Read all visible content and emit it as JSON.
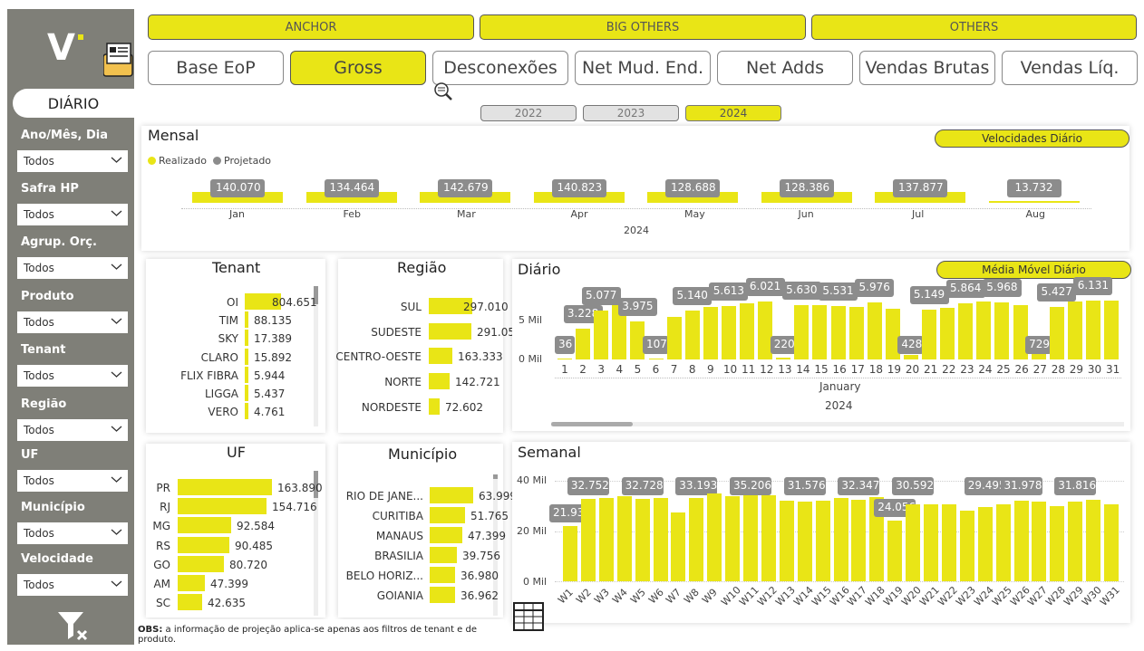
{
  "sidebar": {
    "logo": "V",
    "mode_label": "DIÁRIO",
    "filters": [
      {
        "label": "Ano/Mês, Dia",
        "value": "Todos"
      },
      {
        "label": "Safra HP",
        "value": "Todos"
      },
      {
        "label": "Agrup. Orç.",
        "value": "Todos"
      },
      {
        "label": "Produto",
        "value": "Todos"
      },
      {
        "label": "Tenant",
        "value": "Todos"
      },
      {
        "label": "Região",
        "value": "Todos"
      },
      {
        "label": "UF",
        "value": "Todos"
      },
      {
        "label": "Município",
        "value": "Todos"
      },
      {
        "label": "Velocidade",
        "value": "Todos"
      }
    ]
  },
  "segment_buttons": [
    "ANCHOR",
    "BIG OTHERS",
    "OTHERS"
  ],
  "metric_buttons": [
    {
      "label": "Base EoP",
      "active": false
    },
    {
      "label": "Gross",
      "active": true
    },
    {
      "label": "Desconexões",
      "active": false
    },
    {
      "label": "Net Mud. End.",
      "active": false
    },
    {
      "label": "Net Adds",
      "active": false
    },
    {
      "label": "Vendas Brutas",
      "active": false
    },
    {
      "label": "Vendas Líq.",
      "active": false
    }
  ],
  "year_buttons": [
    {
      "label": "2022",
      "active": false
    },
    {
      "label": "2023",
      "active": false
    },
    {
      "label": "2024",
      "active": true
    }
  ],
  "mensal": {
    "title": "Mensal",
    "pill": "Velocidades Diário",
    "legend": [
      "Realizado",
      "Projetado"
    ],
    "year": "2024",
    "months": [
      {
        "m": "Jan",
        "v": "140.070",
        "n": 140070
      },
      {
        "m": "Feb",
        "v": "134.464",
        "n": 134464
      },
      {
        "m": "Mar",
        "v": "142.679",
        "n": 142679
      },
      {
        "m": "Apr",
        "v": "140.823",
        "n": 140823
      },
      {
        "m": "May",
        "v": "128.688",
        "n": 128688
      },
      {
        "m": "Jun",
        "v": "128.386",
        "n": 128386
      },
      {
        "m": "Jul",
        "v": "137.877",
        "n": 137877
      },
      {
        "m": "Aug",
        "v": "13.732",
        "n": 13732
      }
    ]
  },
  "tenant": {
    "title": "Tenant",
    "rows": [
      {
        "k": "OI",
        "v": "804.651",
        "n": 804651
      },
      {
        "k": "TIM",
        "v": "88.135",
        "n": 88135
      },
      {
        "k": "SKY",
        "v": "17.389",
        "n": 17389
      },
      {
        "k": "CLARO",
        "v": "15.892",
        "n": 15892
      },
      {
        "k": "FLIX FIBRA",
        "v": "5.944",
        "n": 5944
      },
      {
        "k": "LIGGA",
        "v": "5.437",
        "n": 5437
      },
      {
        "k": "VERO",
        "v": "4.761",
        "n": 4761
      }
    ]
  },
  "regiao": {
    "title": "Região",
    "rows": [
      {
        "k": "SUL",
        "v": "297.010",
        "n": 297010
      },
      {
        "k": "SUDESTE",
        "v": "291.053",
        "n": 291053
      },
      {
        "k": "CENTRO-OESTE",
        "v": "163.333",
        "n": 163333
      },
      {
        "k": "NORTE",
        "v": "142.721",
        "n": 142721
      },
      {
        "k": "NORDESTE",
        "v": "72.602",
        "n": 72602
      }
    ]
  },
  "uf": {
    "title": "UF",
    "rows": [
      {
        "k": "PR",
        "v": "163.890",
        "n": 163890
      },
      {
        "k": "RJ",
        "v": "154.716",
        "n": 154716
      },
      {
        "k": "MG",
        "v": "92.584",
        "n": 92584
      },
      {
        "k": "RS",
        "v": "90.485",
        "n": 90485
      },
      {
        "k": "GO",
        "v": "80.720",
        "n": 80720
      },
      {
        "k": "AM",
        "v": "47.399",
        "n": 47399
      },
      {
        "k": "SC",
        "v": "42.635",
        "n": 42635
      }
    ]
  },
  "municipio": {
    "title": "Município",
    "rows": [
      {
        "k": "RIO DE JANE...",
        "v": "63.999",
        "n": 63999
      },
      {
        "k": "CURITIBA",
        "v": "51.765",
        "n": 51765
      },
      {
        "k": "MANAUS",
        "v": "47.399",
        "n": 47399
      },
      {
        "k": "BRASILIA",
        "v": "39.756",
        "n": 39756
      },
      {
        "k": "BELO HORIZ...",
        "v": "36.980",
        "n": 36980
      },
      {
        "k": "GOIANIA",
        "v": "36.962",
        "n": 36962
      }
    ]
  },
  "diario": {
    "title": "Diário",
    "pill": "Média Móvel Diário",
    "y_ticks": [
      "5 Mil",
      "0 Mil"
    ],
    "x_month": "January",
    "x_year": "2024"
  },
  "semanal": {
    "title": "Semanal",
    "y_ticks": [
      "40 Mil",
      "20 Mil",
      "0 Mil"
    ]
  },
  "obs": {
    "bold": "OBS:",
    "text": " a informação de projeção aplica-se apenas aos filtros de tenant e de produto."
  },
  "chart_data": [
    {
      "type": "bar",
      "title": "Diário",
      "categories": [
        "1",
        "2",
        "3",
        "4",
        "5",
        "6",
        "7",
        "8",
        "9",
        "10",
        "11",
        "12",
        "13",
        "14",
        "15",
        "16",
        "17",
        "18",
        "19",
        "20",
        "21",
        "22",
        "23",
        "24",
        "25",
        "26",
        "27",
        "28",
        "29",
        "30",
        "31"
      ],
      "values": [
        36,
        3228,
        5077,
        5650,
        3975,
        107,
        4400,
        5140,
        5450,
        5613,
        5850,
        6021,
        220,
        5630,
        5700,
        5531,
        5500,
        5976,
        5250,
        428,
        5149,
        5400,
        5864,
        6000,
        5968,
        5700,
        729,
        5427,
        6000,
        6131,
        6131
      ],
      "labels": [
        "36",
        "3.228",
        "5.077",
        "",
        "3.975",
        "107",
        "",
        "5.140",
        "",
        "5.613",
        "",
        "6.021",
        "220",
        "5.630",
        "",
        "5.531",
        "",
        "5.976",
        "",
        "428",
        "5.149",
        "",
        "5.864",
        "",
        "5.968",
        "",
        "729",
        "5.427",
        "",
        "6.131",
        ""
      ],
      "ylim": [
        0,
        7000
      ],
      "xlabel": "January",
      "x_year": "2024"
    },
    {
      "type": "bar",
      "title": "Semanal",
      "categories": [
        "W1",
        "W2",
        "W3",
        "W4",
        "W5",
        "W6",
        "W7",
        "W8",
        "W9",
        "W10",
        "W11",
        "W12",
        "W13",
        "W14",
        "W15",
        "W16",
        "W17",
        "W18",
        "W19",
        "W20",
        "W21",
        "W22",
        "W23",
        "W24",
        "W25",
        "W26",
        "W27",
        "W28",
        "W29",
        "W30",
        "W31"
      ],
      "values": [
        21939,
        32752,
        33000,
        33900,
        32728,
        33200,
        27500,
        33193,
        34800,
        34000,
        35206,
        34400,
        32000,
        31576,
        32000,
        33200,
        32347,
        33600,
        24056,
        30592,
        30600,
        30600,
        28000,
        29495,
        30800,
        31978,
        31600,
        29800,
        31816,
        32400,
        30800
      ],
      "labels": [
        "21.939",
        "32.752",
        "",
        "",
        "32.728",
        "",
        "",
        "33.193",
        "",
        "",
        "35.206",
        "",
        "",
        "31.576",
        "",
        "",
        "32.347",
        "",
        "24.056",
        "30.592",
        "",
        "",
        "",
        "29.495",
        "",
        "31.978",
        "",
        "",
        "31.816",
        "",
        ""
      ],
      "ylim": [
        0,
        40000
      ]
    }
  ]
}
